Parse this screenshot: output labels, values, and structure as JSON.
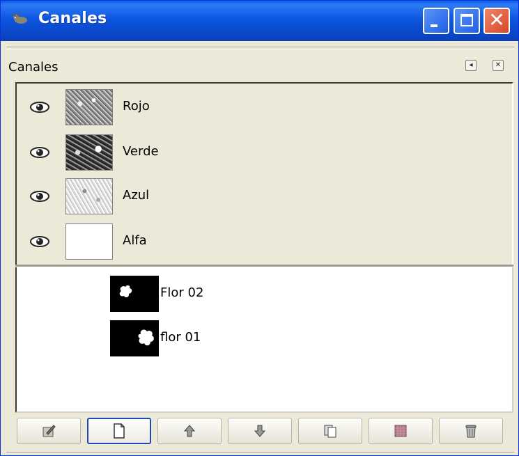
{
  "window": {
    "title": "Canales",
    "icon": "wilber-icon"
  },
  "dock": {
    "tab_title": "Canales",
    "buttons": [
      "dock-menu-icon",
      "dock-close-icon"
    ]
  },
  "channels": [
    {
      "name": "Rojo",
      "visible": true
    },
    {
      "name": "Verde",
      "visible": true
    },
    {
      "name": "Azul",
      "visible": true
    },
    {
      "name": "Alfa",
      "visible": true
    }
  ],
  "selections": [
    {
      "name": "Flor 02"
    },
    {
      "name": "flor 01"
    }
  ],
  "toolbar": {
    "buttons": [
      "edit-channel-icon",
      "new-channel-icon",
      "raise-channel-icon",
      "lower-channel-icon",
      "duplicate-channel-icon",
      "channel-to-selection-icon",
      "delete-channel-icon"
    ]
  }
}
